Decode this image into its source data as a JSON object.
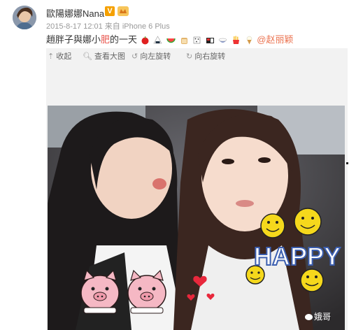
{
  "post": {
    "username": "歐陽娜娜Nana",
    "verified_badge": "V",
    "timestamp": "2015-8-17 12:01",
    "source_prefix": "来自",
    "source": "iPhone 6 Plus",
    "text_part1": "趙胖子與娜小",
    "text_highlight": "肥",
    "text_part2": "的一天",
    "mention": "@赵丽颖",
    "emojis": [
      "apple-emoji",
      "rice-ball-emoji",
      "watermelon-emoji",
      "bread-emoji",
      "cookie-emoji",
      "bento-emoji",
      "rice-bowl-emoji",
      "fries-emoji",
      "ice-cream-emoji"
    ]
  },
  "toolbar": {
    "collapse_label": "收起",
    "view_large_label": "查看大图",
    "rotate_left_label": "向左旋转",
    "rotate_right_label": "向右旋转"
  },
  "photo": {
    "stickers": [
      "smiley-face",
      "HAPPY",
      "pig-face",
      "hearts"
    ],
    "happy_text": "HAPPY",
    "watermark": "娥哥"
  },
  "colors": {
    "accent": "#eb7350",
    "highlight": "#e8534b",
    "meta": "#999999",
    "badge": "#f5a000"
  }
}
